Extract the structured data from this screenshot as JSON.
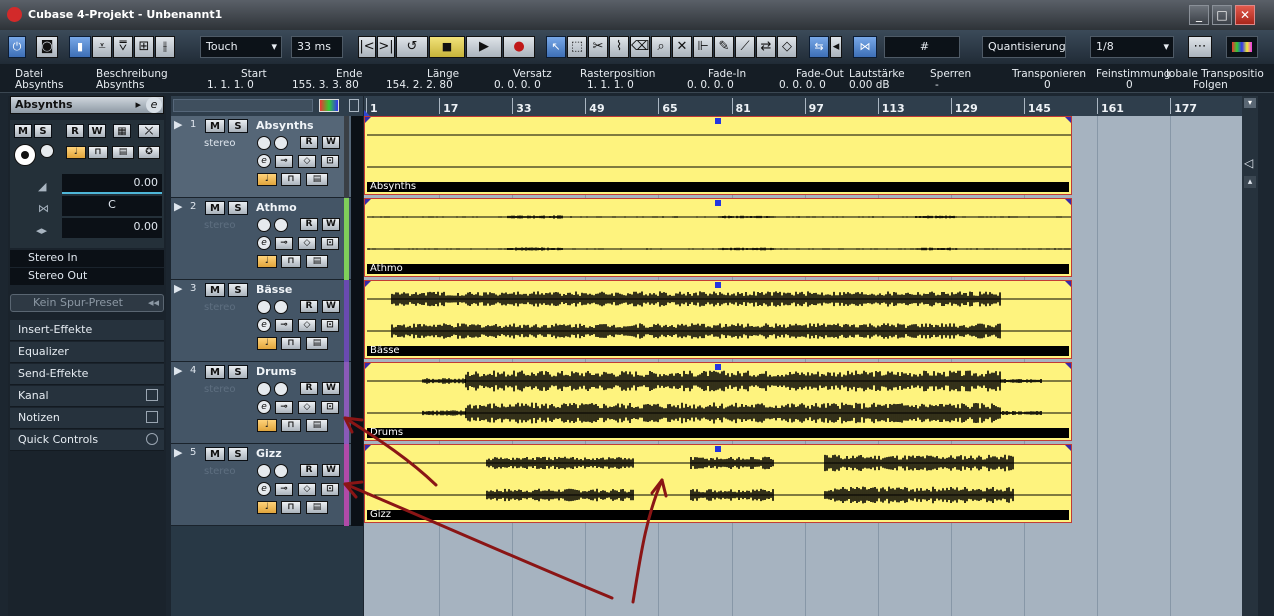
{
  "window": {
    "title": "Cubase 4-Projekt - Unbenannt1",
    "controls": [
      "_",
      "□",
      "✕"
    ]
  },
  "toolbar": {
    "automation_mode": "Touch",
    "latency": "33 ms",
    "snap_label": "Quantisierung",
    "quantize_value": "1/8"
  },
  "infoline": {
    "columns": [
      {
        "label": "Datei",
        "value": "Absynths"
      },
      {
        "label": "Beschreibung",
        "value": "Absynths"
      },
      {
        "label": "Start",
        "value": "1. 1. 1.   0"
      },
      {
        "label": "Ende",
        "value": "155. 3. 3. 80"
      },
      {
        "label": "Länge",
        "value": "154. 2. 2. 80"
      },
      {
        "label": "Versatz",
        "value": "0. 0. 0.   0"
      },
      {
        "label": "Rasterposition",
        "value": "1. 1. 1.   0"
      },
      {
        "label": "Fade-In",
        "value": "0. 0. 0.   0"
      },
      {
        "label": "Fade-Out",
        "value": "0. 0. 0.   0"
      },
      {
        "label": "Lautstärke",
        "value": "0.00 dB"
      },
      {
        "label": "Sperren",
        "value": "-"
      },
      {
        "label": "Transponieren",
        "value": "0"
      },
      {
        "label": "Feinstimmung",
        "value": "0"
      },
      {
        "label": "lobale Transpositio",
        "value": "Folgen"
      }
    ]
  },
  "inspector": {
    "track_name": "Absynths",
    "buttons": {
      "mute": "M",
      "solo": "S",
      "read": "R",
      "write": "W"
    },
    "volume_value": "0.00",
    "pan_value": "C",
    "delay_value": "0.00",
    "routing": [
      "Stereo In",
      "Stereo Out"
    ],
    "preset_placeholder": "Kein Spur-Preset",
    "sections": [
      "Insert-Effekte",
      "Equalizer",
      "Send-Effekte",
      "Kanal",
      "Notizen",
      "Quick Controls"
    ]
  },
  "tracks": [
    {
      "num": "1",
      "name": "Absynths",
      "channel": "stereo",
      "color": "#3a3f45"
    },
    {
      "num": "2",
      "name": "Athmo",
      "channel": "stereo",
      "color": "#7fcf5a"
    },
    {
      "num": "3",
      "name": "Bässe",
      "channel": "stereo",
      "color": "#6a4ab0"
    },
    {
      "num": "4",
      "name": "Drums",
      "channel": "stereo",
      "color": "#8a5ab8"
    },
    {
      "num": "5",
      "name": "Gizz",
      "channel": "stereo",
      "color": "#b04aa8"
    }
  ],
  "track_buttons": {
    "mute": "M",
    "solo": "S",
    "read": "R",
    "write": "W",
    "edit": "e"
  },
  "ruler": {
    "bars": [
      "1",
      "17",
      "33",
      "49",
      "65",
      "81",
      "97",
      "113",
      "129",
      "145",
      "161",
      "177"
    ]
  },
  "clips": [
    {
      "name": "Absynths"
    },
    {
      "name": "Athmo"
    },
    {
      "name": "Bässe"
    },
    {
      "name": "Drums"
    },
    {
      "name": "Gizz"
    }
  ],
  "colors": {
    "clip_fill": "#fef37e",
    "arrow": "#8a1515"
  }
}
